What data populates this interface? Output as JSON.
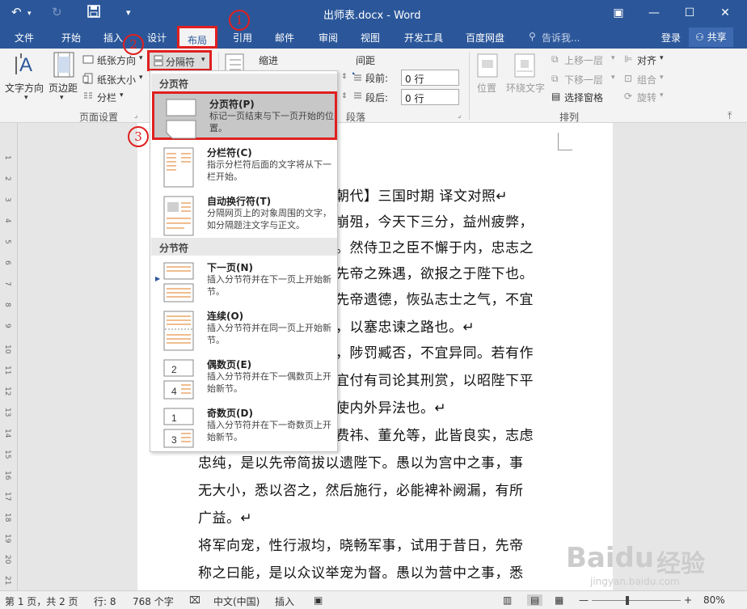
{
  "window": {
    "title": "出师表.docx - Word",
    "controls": {
      "minimize": "—",
      "maximize": "☐",
      "close": "✕",
      "ribbon_options": "▣"
    }
  },
  "tabs": {
    "file": "文件",
    "home": "开始",
    "insert": "插入",
    "design": "设计",
    "layout": "布局",
    "references": "引用",
    "mailings": "邮件",
    "review": "审阅",
    "view": "视图",
    "developer": "开发工具",
    "baidu": "百度网盘",
    "tell_me": "告诉我...",
    "login": "登录",
    "share": "共享"
  },
  "ribbon": {
    "text_direction": "文字方向",
    "margins": "页边距",
    "orientation": "纸张方向",
    "size": "纸张大小",
    "columns": "分栏",
    "breaks": "分隔符",
    "page_setup_group": "页面设置",
    "indent_label": "缩进",
    "spacing_label": "间距",
    "before_label": "段前:",
    "after_label": "段后:",
    "before_value": "0 行",
    "after_value": "0 行",
    "paragraph_group": "段落",
    "position": "位置",
    "wrap_text": "环绕文字",
    "bring_forward": "上移一层",
    "send_backward": "下移一层",
    "selection_pane": "选择窗格",
    "align": "对齐",
    "group": "组合",
    "rotate": "旋转",
    "arrange_group": "排列"
  },
  "dropdown": {
    "section_page": "分页符",
    "section_section": "分节符",
    "items": [
      {
        "title": "分页符(P)",
        "desc": "标记一页结束与下一页开始的位置。"
      },
      {
        "title": "分栏符(C)",
        "desc": "指示分栏符后面的文字将从下一栏开始。"
      },
      {
        "title": "自动换行符(T)",
        "desc": "分隔网页上的对象周围的文字，如分隔题注文字与正文。"
      },
      {
        "title": "下一页(N)",
        "desc": "插入分节符并在下一页上开始新节。"
      },
      {
        "title": "连续(O)",
        "desc": "插入分节符并在同一页上开始新节。"
      },
      {
        "title": "偶数页(E)",
        "desc": "插入分节符并在下一偶数页上开始新节。"
      },
      {
        "title": "奇数页(D)",
        "desc": "插入分节符并在下一奇数页上开始新节。"
      }
    ]
  },
  "annotations": {
    "one": "1",
    "two": "2",
    "three": "3"
  },
  "document": {
    "lines": [
      "朝代】三国时期  译文对照↵",
      "崩殂，今天下三分，益州疲弊，",
      "。然侍卫之臣不懈于内，忠志之",
      "先帝之殊遇，欲报之于陛下也。",
      "先帝遗德，恢弘志士之气，不宜",
      "，以塞忠谏之路也。↵",
      "，陟罚臧否，不宜异同。若有作",
      "宜付有司论其刑赏，以昭陛下平",
      "使内外异法也。↵",
      "费祎、董允等，此皆良实，志虑",
      "忠纯，是以先帝简拔以遗陛下。愚以为宫中之事，事",
      "无大小，悉以咨之，然后施行，必能裨补阙漏，有所",
      "广益。↵",
      "将军向宠，性行淑均，晓畅军事，试用于昔日，先帝",
      "称之曰能，是以众议举宠为督。愚以为营中之事，悉"
    ]
  },
  "ruler_numbers": [
    "1",
    "2",
    "3",
    "4",
    "5",
    "6",
    "7",
    "8",
    "9",
    "10",
    "11",
    "12",
    "13",
    "14",
    "15",
    "16",
    "17",
    "18",
    "19",
    "20",
    "21",
    "22"
  ],
  "status": {
    "page": "第 1 页，共 2 页",
    "words": "行: 8",
    "chars": "768 个字",
    "language": "中文(中国)",
    "mode": "插入",
    "zoom": "80%"
  },
  "watermark": {
    "brand": "Baidu",
    "brand_cn": "经验",
    "url": "jingyan.baidu.com"
  },
  "colors": {
    "accent": "#2b579a",
    "annotation": "#e0201f",
    "highlight": "#c7c7c7"
  }
}
